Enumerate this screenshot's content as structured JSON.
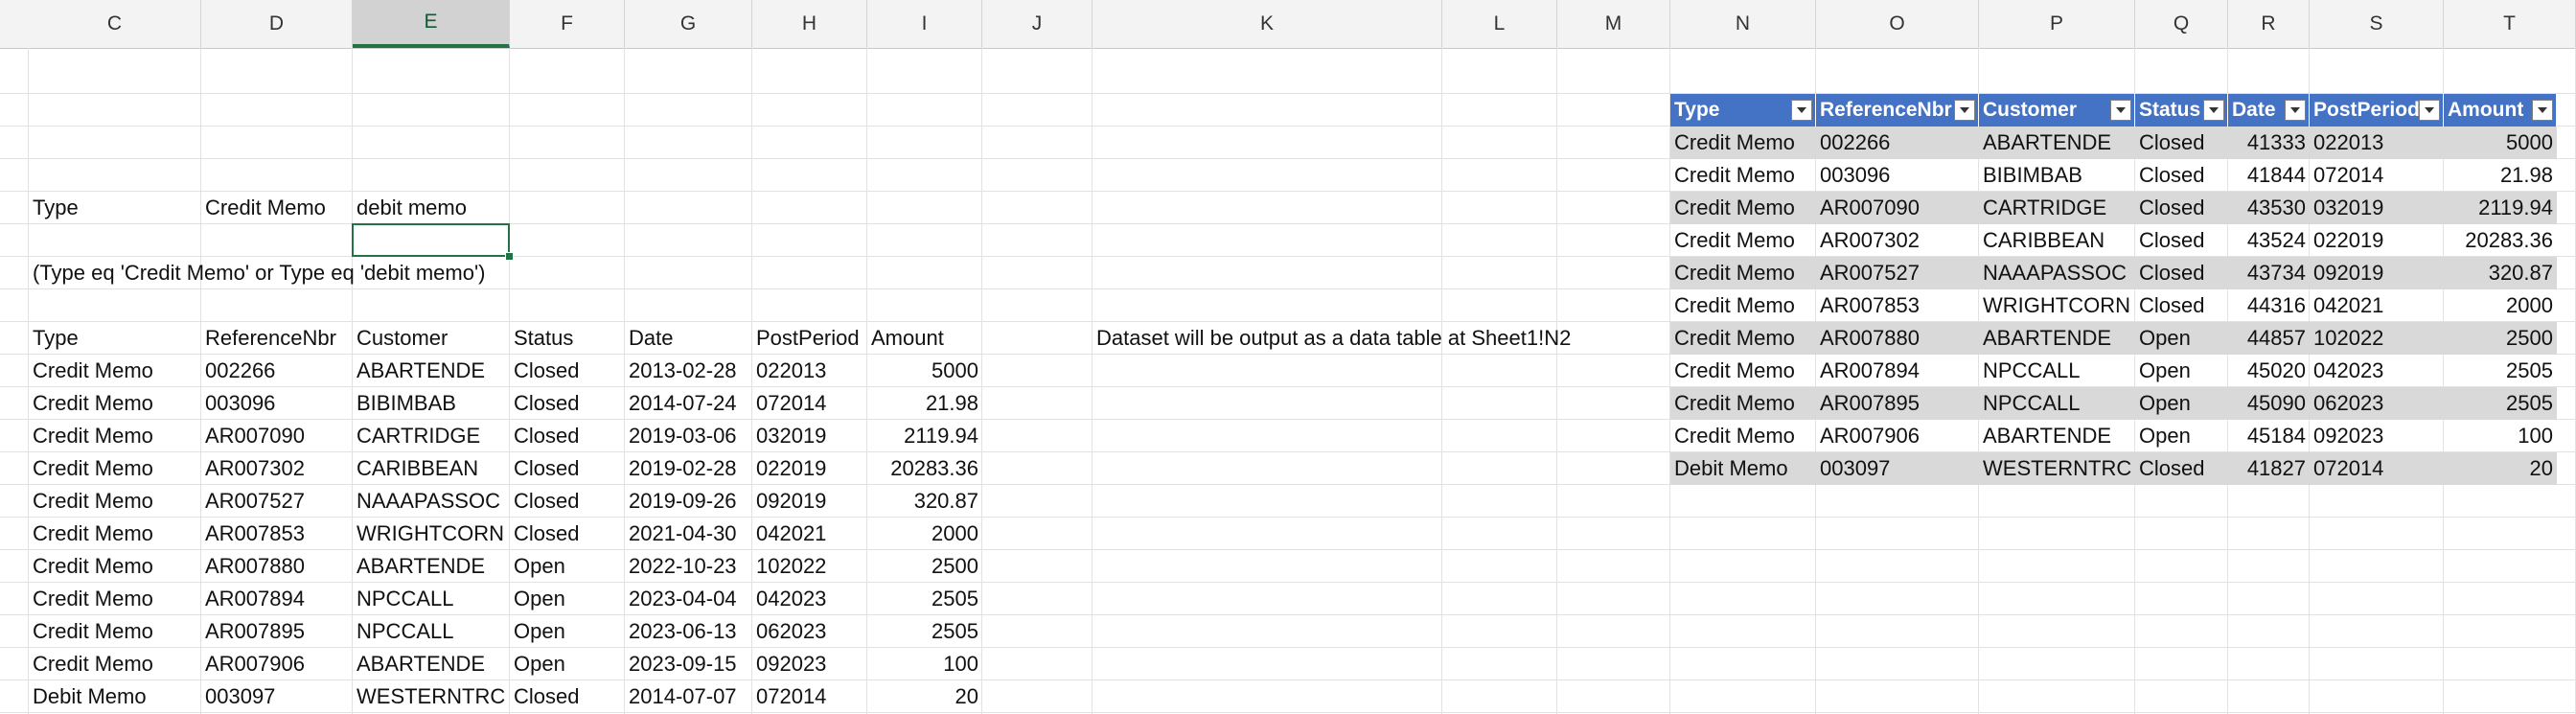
{
  "columns": [
    "C",
    "D",
    "E",
    "F",
    "G",
    "H",
    "I",
    "J",
    "K",
    "L",
    "M",
    "N",
    "O",
    "P",
    "Q",
    "R",
    "S",
    "T"
  ],
  "active_column": "E",
  "accent_color": "#217346",
  "table_header_color": "#4472c4",
  "band_color": "#d9d9d9",
  "params": {
    "type_label": "Type",
    "value1": "Credit Memo",
    "value2": "debit memo"
  },
  "filter_expression": "(Type eq 'Credit Memo' or Type eq 'debit memo')",
  "output_note": "Dataset will be output as a data table at Sheet1!N2",
  "source_table": {
    "headers": [
      "Type",
      "ReferenceNbr",
      "Customer",
      "Status",
      "Date",
      "PostPeriod",
      "Amount"
    ],
    "rows": [
      [
        "Credit Memo",
        "002266",
        "ABARTENDE",
        "Closed",
        "2013-02-28",
        "022013",
        "5000"
      ],
      [
        "Credit Memo",
        "003096",
        "BIBIMBAB",
        "Closed",
        "2014-07-24",
        "072014",
        "21.98"
      ],
      [
        "Credit Memo",
        "AR007090",
        "CARTRIDGE",
        "Closed",
        "2019-03-06",
        "032019",
        "2119.94"
      ],
      [
        "Credit Memo",
        "AR007302",
        "CARIBBEAN",
        "Closed",
        "2019-02-28",
        "022019",
        "20283.36"
      ],
      [
        "Credit Memo",
        "AR007527",
        "NAAAPASSOC",
        "Closed",
        "2019-09-26",
        "092019",
        "320.87"
      ],
      [
        "Credit Memo",
        "AR007853",
        "WRIGHTCORN",
        "Closed",
        "2021-04-30",
        "042021",
        "2000"
      ],
      [
        "Credit Memo",
        "AR007880",
        "ABARTENDE",
        "Open",
        "2022-10-23",
        "102022",
        "2500"
      ],
      [
        "Credit Memo",
        "AR007894",
        "NPCCALL",
        "Open",
        "2023-04-04",
        "042023",
        "2505"
      ],
      [
        "Credit Memo",
        "AR007895",
        "NPCCALL",
        "Open",
        "2023-06-13",
        "062023",
        "2505"
      ],
      [
        "Credit Memo",
        "AR007906",
        "ABARTENDE",
        "Open",
        "2023-09-15",
        "092023",
        "100"
      ],
      [
        "Debit Memo",
        "003097",
        "WESTERNTRC",
        "Closed",
        "2014-07-07",
        "072014",
        "20"
      ]
    ]
  },
  "output_table": {
    "headers": [
      "Type",
      "ReferenceNbr",
      "Customer",
      "Status",
      "Date",
      "PostPeriod",
      "Amount"
    ],
    "rows": [
      [
        "Credit Memo",
        "002266",
        "ABARTENDE",
        "Closed",
        "41333",
        "022013",
        "5000"
      ],
      [
        "Credit Memo",
        "003096",
        "BIBIMBAB",
        "Closed",
        "41844",
        "072014",
        "21.98"
      ],
      [
        "Credit Memo",
        "AR007090",
        "CARTRIDGE",
        "Closed",
        "43530",
        "032019",
        "2119.94"
      ],
      [
        "Credit Memo",
        "AR007302",
        "CARIBBEAN",
        "Closed",
        "43524",
        "022019",
        "20283.36"
      ],
      [
        "Credit Memo",
        "AR007527",
        "NAAAPASSOC",
        "Closed",
        "43734",
        "092019",
        "320.87"
      ],
      [
        "Credit Memo",
        "AR007853",
        "WRIGHTCORN",
        "Closed",
        "44316",
        "042021",
        "2000"
      ],
      [
        "Credit Memo",
        "AR007880",
        "ABARTENDE",
        "Open",
        "44857",
        "102022",
        "2500"
      ],
      [
        "Credit Memo",
        "AR007894",
        "NPCCALL",
        "Open",
        "45020",
        "042023",
        "2505"
      ],
      [
        "Credit Memo",
        "AR007895",
        "NPCCALL",
        "Open",
        "45090",
        "062023",
        "2505"
      ],
      [
        "Credit Memo",
        "AR007906",
        "ABARTENDE",
        "Open",
        "45184",
        "092023",
        "100"
      ],
      [
        "Debit Memo",
        "003097",
        "WESTERNTRC",
        "Closed",
        "41827",
        "072014",
        "20"
      ]
    ]
  }
}
